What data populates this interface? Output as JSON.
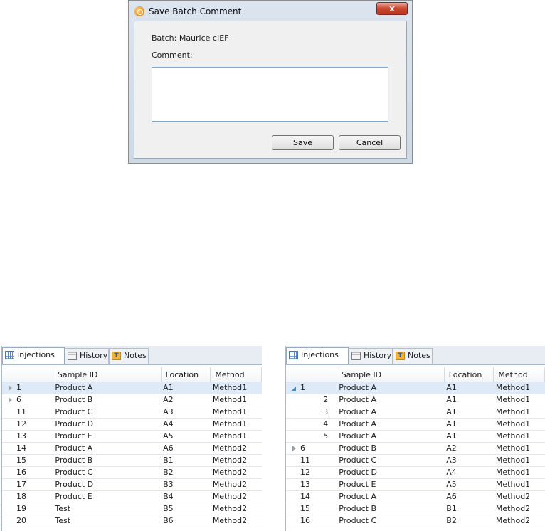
{
  "dialog": {
    "title": "Save Batch Comment",
    "close_glyph": "x",
    "batch_text": "Batch: Maurice cIEF",
    "comment_label": "Comment:",
    "comment_value": "",
    "save_label": "Save",
    "cancel_label": "Cancel"
  },
  "tabs": {
    "injections": "Injections",
    "history": "History",
    "notes": "Notes",
    "notes_icon_letter": "T"
  },
  "columns": [
    "",
    "Sample ID",
    "Location",
    "Method"
  ],
  "left_panel": {
    "rows": [
      {
        "id": "1",
        "sample": "Product A",
        "location": "A1",
        "method": "Method1",
        "expander": "collapsed",
        "selected": true
      },
      {
        "id": "6",
        "sample": "Product B",
        "location": "A2",
        "method": "Method1",
        "expander": "collapsed",
        "selected": false
      },
      {
        "id": "11",
        "sample": "Product C",
        "location": "A3",
        "method": "Method1",
        "expander": "none",
        "selected": false
      },
      {
        "id": "12",
        "sample": "Product D",
        "location": "A4",
        "method": "Method1",
        "expander": "none",
        "selected": false
      },
      {
        "id": "13",
        "sample": "Product E",
        "location": "A5",
        "method": "Method1",
        "expander": "none",
        "selected": false
      },
      {
        "id": "14",
        "sample": "Product A",
        "location": "A6",
        "method": "Method2",
        "expander": "none",
        "selected": false
      },
      {
        "id": "15",
        "sample": "Product B",
        "location": "B1",
        "method": "Method2",
        "expander": "none",
        "selected": false
      },
      {
        "id": "16",
        "sample": "Product C",
        "location": "B2",
        "method": "Method2",
        "expander": "none",
        "selected": false
      },
      {
        "id": "17",
        "sample": "Product D",
        "location": "B3",
        "method": "Method2",
        "expander": "none",
        "selected": false
      },
      {
        "id": "18",
        "sample": "Product E",
        "location": "B4",
        "method": "Method2",
        "expander": "none",
        "selected": false
      },
      {
        "id": "19",
        "sample": "Test",
        "location": "B5",
        "method": "Method2",
        "expander": "none",
        "selected": false
      },
      {
        "id": "20",
        "sample": "Test",
        "location": "B6",
        "method": "Method2",
        "expander": "none",
        "selected": false
      }
    ]
  },
  "right_panel": {
    "rows": [
      {
        "id": "1",
        "sample": "Product A",
        "location": "A1",
        "method": "Method1",
        "expander": "expanded",
        "selected": true,
        "child": false
      },
      {
        "id": "2",
        "sample": "Product A",
        "location": "A1",
        "method": "Method1",
        "expander": "none",
        "selected": false,
        "child": true
      },
      {
        "id": "3",
        "sample": "Product A",
        "location": "A1",
        "method": "Method1",
        "expander": "none",
        "selected": false,
        "child": true
      },
      {
        "id": "4",
        "sample": "Product A",
        "location": "A1",
        "method": "Method1",
        "expander": "none",
        "selected": false,
        "child": true
      },
      {
        "id": "5",
        "sample": "Product A",
        "location": "A1",
        "method": "Method1",
        "expander": "none",
        "selected": false,
        "child": true
      },
      {
        "id": "6",
        "sample": "Product B",
        "location": "A2",
        "method": "Method1",
        "expander": "collapsed",
        "selected": false,
        "child": false
      },
      {
        "id": "11",
        "sample": "Product C",
        "location": "A3",
        "method": "Method1",
        "expander": "none",
        "selected": false,
        "child": false
      },
      {
        "id": "12",
        "sample": "Product D",
        "location": "A4",
        "method": "Method1",
        "expander": "none",
        "selected": false,
        "child": false
      },
      {
        "id": "13",
        "sample": "Product E",
        "location": "A5",
        "method": "Method1",
        "expander": "none",
        "selected": false,
        "child": false
      },
      {
        "id": "14",
        "sample": "Product A",
        "location": "A6",
        "method": "Method2",
        "expander": "none",
        "selected": false,
        "child": false
      },
      {
        "id": "15",
        "sample": "Product B",
        "location": "B1",
        "method": "Method2",
        "expander": "none",
        "selected": false,
        "child": false
      },
      {
        "id": "16",
        "sample": "Product C",
        "location": "B2",
        "method": "Method2",
        "expander": "none",
        "selected": false,
        "child": false
      }
    ]
  }
}
